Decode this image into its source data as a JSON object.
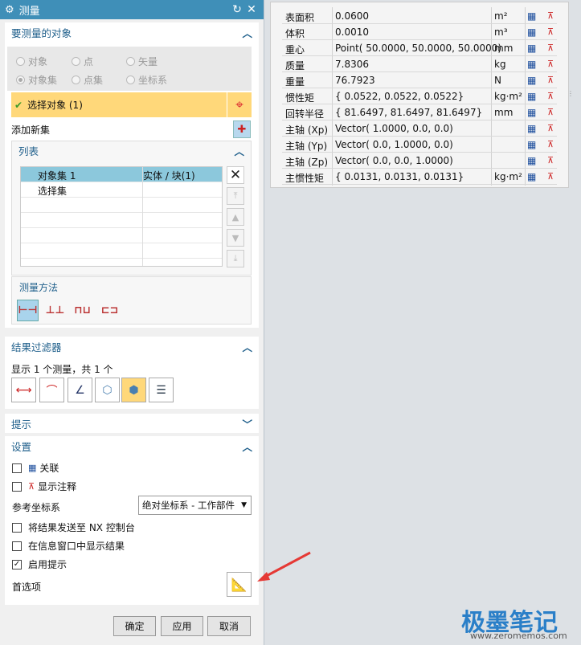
{
  "dialog": {
    "title": "测量",
    "reset_icon": "↻",
    "close_icon": "✕"
  },
  "objects_section": {
    "title": "要测量的对象",
    "radios": [
      "对象",
      "点",
      "矢量",
      "对象集",
      "点集",
      "坐标系"
    ],
    "select_label": "选择对象 (1)",
    "add_set_label": "添加新集"
  },
  "list_section": {
    "title": "列表",
    "rows": [
      {
        "name": "对象集 1",
        "type": "实体 / 块(1)"
      },
      {
        "name": "选择集",
        "type": ""
      }
    ],
    "method_title": "测量方法"
  },
  "filter_section": {
    "title": "结果过滤器",
    "summary": "显示 1 个测量，共 1 个"
  },
  "hint_section": {
    "title": "提示"
  },
  "settings_section": {
    "title": "设置",
    "associate": "关联",
    "show_annotation": "显示注释",
    "ref_csys_label": "参考坐标系",
    "ref_csys_value": "绝对坐标系 - 工作部件",
    "send_to_console": "将结果发送至 NX 控制台",
    "show_in_info": "在信息窗口中显示结果",
    "enable_hint": "启用提示",
    "preferences": "首选项"
  },
  "footer": {
    "ok": "确定",
    "apply": "应用",
    "cancel": "取消"
  },
  "results": [
    {
      "name": "表面积",
      "value": "0.0600",
      "unit": "m²"
    },
    {
      "name": "体积",
      "value": "0.0010",
      "unit": "m³"
    },
    {
      "name": "重心",
      "value": "Point( 50.0000, 50.0000, 50.0000)",
      "unit": "mm"
    },
    {
      "name": "质量",
      "value": "7.8306",
      "unit": "kg"
    },
    {
      "name": "重量",
      "value": "76.7923",
      "unit": "N"
    },
    {
      "name": "惯性矩",
      "value": "{ 0.0522, 0.0522, 0.0522}",
      "unit": "kg·m²"
    },
    {
      "name": "回转半径",
      "value": "{ 81.6497, 81.6497, 81.6497}",
      "unit": "mm"
    },
    {
      "name": "主轴 (Xp)",
      "value": "Vector( 1.0000, 0.0, 0.0)",
      "unit": ""
    },
    {
      "name": "主轴 (Yp)",
      "value": "Vector( 0.0, 1.0000, 0.0)",
      "unit": ""
    },
    {
      "name": "主轴 (Zp)",
      "value": "Vector( 0.0, 0.0, 1.0000)",
      "unit": ""
    },
    {
      "name": "主惯性矩",
      "value": "{ 0.0131, 0.0131, 0.0131}",
      "unit": "kg·m²"
    }
  ],
  "watermark": {
    "title": "极墨笔记",
    "url": "www.zeromemos.com"
  }
}
